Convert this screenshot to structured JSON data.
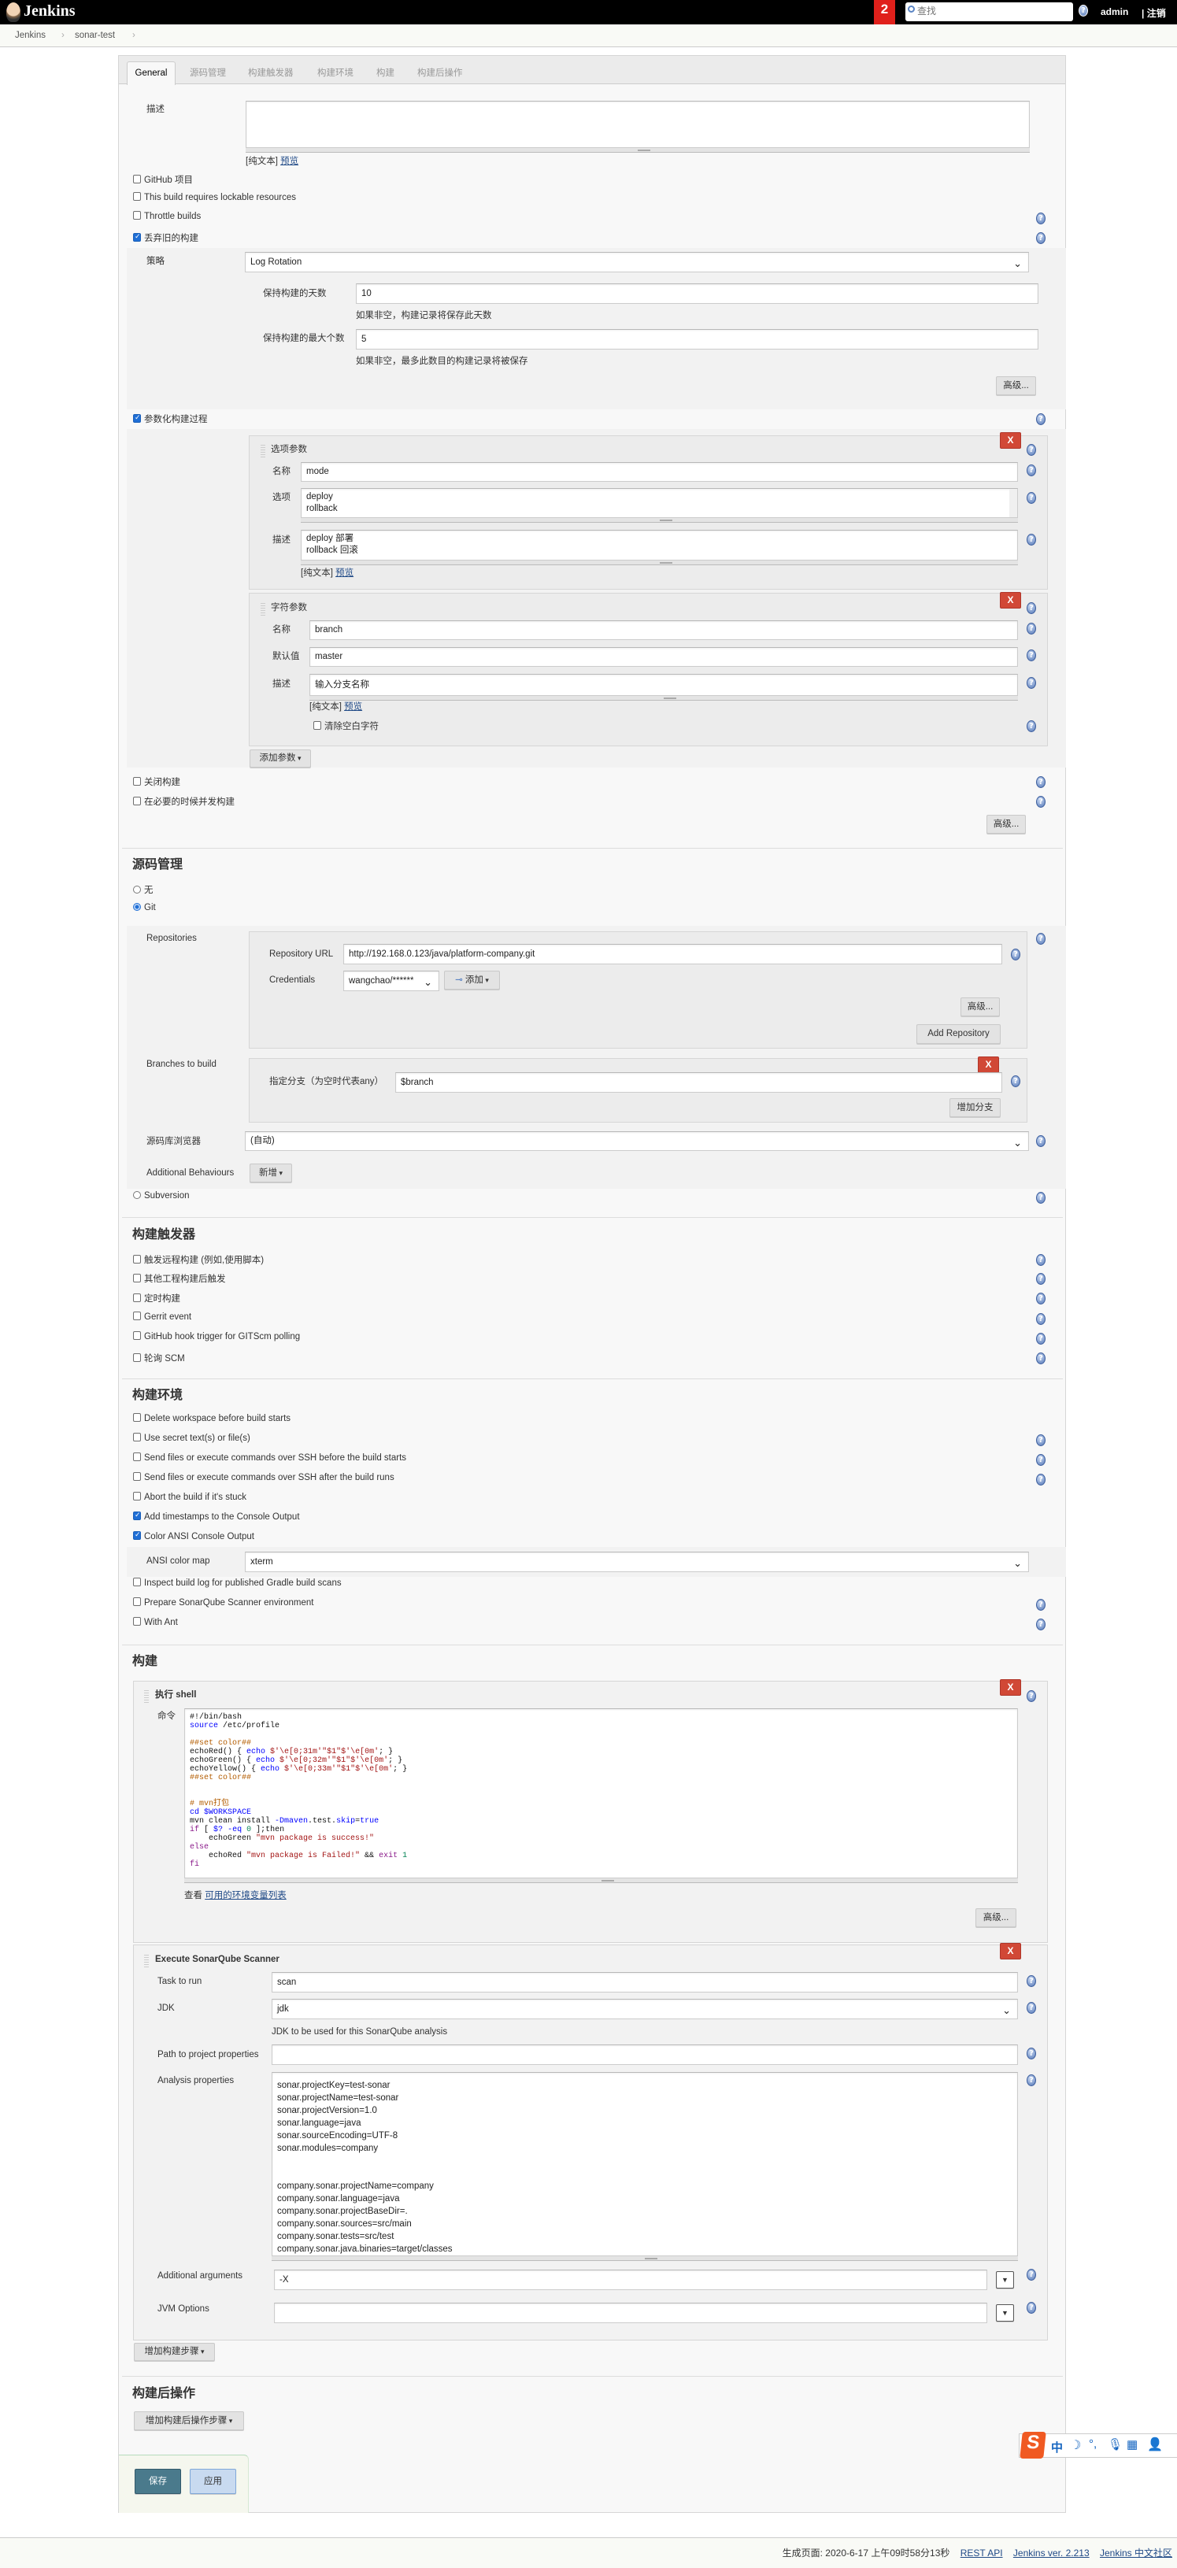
{
  "header": {
    "logo_text": "Jenkins",
    "notification_count": "2",
    "search_placeholder": "查找",
    "user": "admin",
    "logout": "| 注销"
  },
  "breadcrumb": [
    "Jenkins",
    "sonar-test"
  ],
  "tabs": [
    "General",
    "源码管理",
    "构建触发器",
    "构建环境",
    "构建",
    "构建后操作"
  ],
  "general": {
    "description_label": "描述",
    "plain_text": "[纯文本]",
    "preview": "预览",
    "options": [
      {
        "label": "GitHub 项目",
        "checked": false
      },
      {
        "label": "This build requires lockable resources",
        "checked": false
      },
      {
        "label": "Throttle builds",
        "checked": false
      },
      {
        "label": "丢弃旧的构建",
        "checked": true
      }
    ],
    "discard": {
      "strategy_label": "策略",
      "strategy_value": "Log Rotation",
      "days_label": "保持构建的天数",
      "days_value": "10",
      "days_hint": "如果非空，构建记录将保存此天数",
      "max_label": "保持构建的最大个数",
      "max_value": "5",
      "max_hint": "如果非空，最多此数目的构建记录将被保存",
      "advanced": "高级..."
    },
    "parameterized": {
      "label": "参数化构建过程",
      "checked": true
    },
    "choice_param": {
      "title": "选项参数",
      "name_label": "名称",
      "name_value": "mode",
      "choices_label": "选项",
      "choices": [
        "deploy",
        "rollback"
      ],
      "desc_label": "描述",
      "desc_lines": [
        "deploy 部署",
        "rollback 回滚"
      ]
    },
    "string_param": {
      "title": "字符参数",
      "name_label": "名称",
      "name_value": "branch",
      "default_label": "默认值",
      "default_value": "master",
      "desc_label": "描述",
      "desc_value": "输入分支名称",
      "trim_label": "清除空白字符"
    },
    "add_param": "添加参数",
    "disable_build": "关闭构建",
    "concurrent": "在必要的时候并发构建",
    "advanced": "高级...",
    "delete_label": "X"
  },
  "scm": {
    "title": "源码管理",
    "none": "无",
    "git": "Git",
    "repositories_label": "Repositories",
    "repo_url_label": "Repository URL",
    "repo_url": "http://192.168.0.123/java/platform-company.git",
    "credentials_label": "Credentials",
    "credentials_value": "wangchao/******",
    "add": "添加",
    "advanced": "高级...",
    "add_repository": "Add Repository",
    "branches_label": "Branches to build",
    "branch_spec_label": "指定分支（为空时代表any）",
    "branch_spec": "$branch",
    "add_branch": "增加分支",
    "browser_label": "源码库浏览器",
    "browser_value": "(自动)",
    "behaviours_label": "Additional Behaviours",
    "behaviours_add": "新增",
    "subversion": "Subversion"
  },
  "triggers": {
    "title": "构建触发器",
    "items": [
      "触发远程构建 (例如,使用脚本)",
      "其他工程构建后触发",
      "定时构建",
      "Gerrit event",
      "GitHub hook trigger for GITScm polling",
      "轮询 SCM"
    ]
  },
  "environment": {
    "title": "构建环境",
    "items": [
      {
        "label": "Delete workspace before build starts",
        "checked": false
      },
      {
        "label": "Use secret text(s) or file(s)",
        "checked": false
      },
      {
        "label": "Send files or execute commands over SSH before the build starts",
        "checked": false
      },
      {
        "label": "Send files or execute commands over SSH after the build runs",
        "checked": false
      },
      {
        "label": "Abort the build if it's stuck",
        "checked": false
      },
      {
        "label": "Add timestamps to the Console Output",
        "checked": true
      },
      {
        "label": "Color ANSI Console Output",
        "checked": true
      },
      {
        "label": "Inspect build log for published Gradle build scans",
        "checked": false
      },
      {
        "label": "Prepare SonarQube Scanner environment",
        "checked": false
      },
      {
        "label": "With Ant",
        "checked": false
      }
    ],
    "ansi_label": "ANSI color map",
    "ansi_value": "xterm"
  },
  "build": {
    "title": "构建",
    "shell": {
      "title": "执行 shell",
      "command_label": "命令",
      "code": [
        "#!/bin/bash",
        "source /etc/profile",
        "",
        "##set color##",
        "echoRed() { echo $'\\e[0;31m'\"$1\"$'\\e[0m'; }",
        "echoGreen() { echo $'\\e[0;32m'\"$1\"$'\\e[0m'; }",
        "echoYellow() { echo $'\\e[0;33m'\"$1\"$'\\e[0m'; }",
        "##set color##",
        "",
        "",
        "# mvn打包",
        "cd $WORKSPACE",
        "mvn clean install -Dmaven.test.skip=true",
        "if [ $? -eq 0 ];then",
        "    echoGreen \"mvn package is success!\"",
        "else",
        "    echoRed \"mvn package is Failed!\" && exit 1",
        "fi"
      ],
      "env_prefix": "查看",
      "env_link": "可用的环境变量列表",
      "advanced": "高级..."
    },
    "sonar": {
      "title": "Execute SonarQube Scanner",
      "task_label": "Task to run",
      "task_value": "scan",
      "jdk_label": "JDK",
      "jdk_value": "jdk",
      "jdk_hint": "JDK to be used for this SonarQube analysis",
      "path_label": "Path to project properties",
      "path_value": "",
      "analysis_label": "Analysis properties",
      "analysis_text": "sonar.projectKey=test-sonar\nsonar.projectName=test-sonar\nsonar.projectVersion=1.0\nsonar.language=java\nsonar.sourceEncoding=UTF-8\nsonar.modules=company\n\n\ncompany.sonar.projectName=company\ncompany.sonar.language=java\ncompany.sonar.projectBaseDir=.\ncompany.sonar.sources=src/main\ncompany.sonar.tests=src/test\ncompany.sonar.java.binaries=target/classes",
      "args_label": "Additional arguments",
      "args_value": "-X",
      "jvm_label": "JVM Options",
      "jvm_value": ""
    },
    "add_step": "增加构建步骤"
  },
  "post_build": {
    "title": "构建后操作",
    "add_step": "增加构建后操作步骤"
  },
  "actions": {
    "save": "保存",
    "apply": "应用"
  },
  "ime": {
    "mode": "中"
  },
  "footer": {
    "generated": "生成页面: 2020-6-17 上午09时58分13秒",
    "rest_api": "REST API",
    "version": "Jenkins ver. 2.213",
    "community": "Jenkins 中文社区"
  },
  "colors": {
    "header_bg": "#000000",
    "badge": "#e0201b",
    "delete": "#d14836",
    "save": "#4a7a8c",
    "apply": "#c8daf0",
    "link": "#204a87"
  }
}
